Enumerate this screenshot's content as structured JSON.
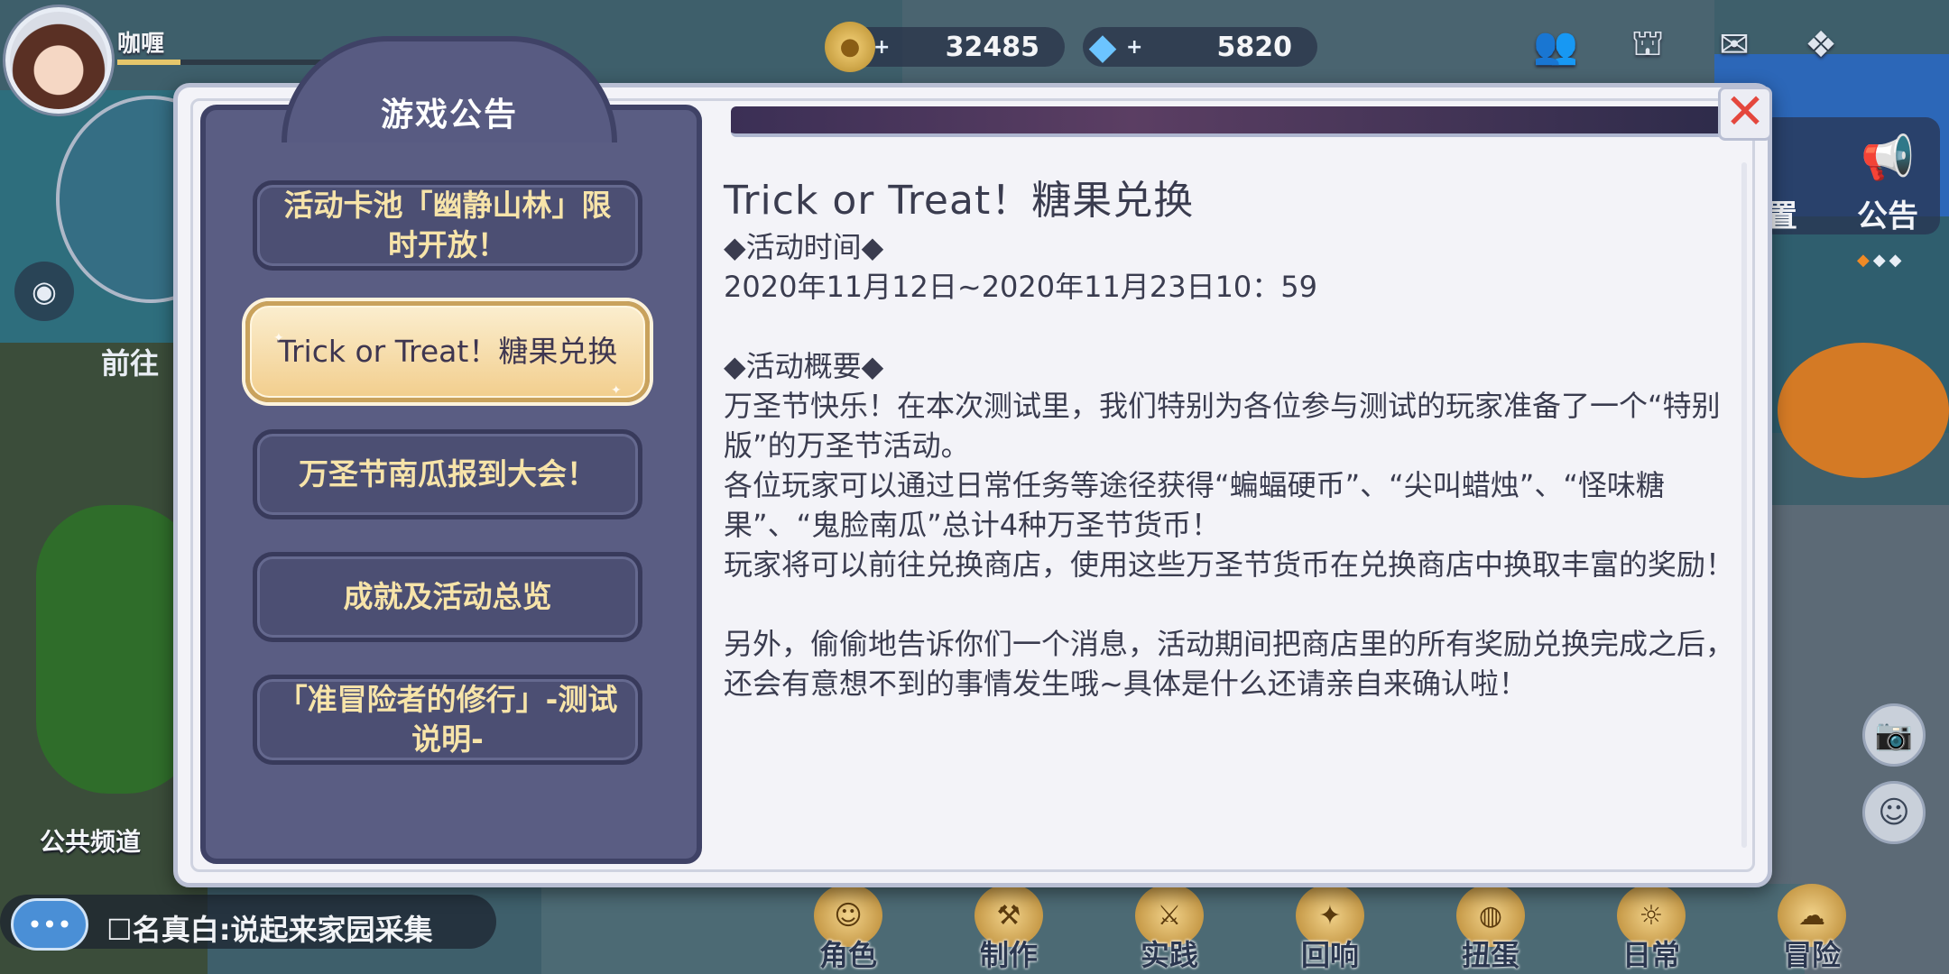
{
  "player": {
    "name": "咖喱",
    "exp_fraction": 0.28
  },
  "currencies": {
    "gold": {
      "value": "32485",
      "icon": "gold-coin-icon",
      "plus": "+"
    },
    "gem": {
      "value": "5820",
      "icon": "crystal-gem-icon",
      "plus": "+"
    }
  },
  "top_icons": [
    "friends-icon",
    "bag-icon",
    "mail-icon",
    "menu-diamond-icon"
  ],
  "side": {
    "settings_partial": "置",
    "announcement": "公告"
  },
  "left": {
    "goto_partial": "前往",
    "channel": "公共频道"
  },
  "chat": {
    "bubble": "•••",
    "message": "☐名真白:说起来家园采集"
  },
  "bottom_menu": [
    {
      "label": "角色",
      "icon": "character-icon"
    },
    {
      "label": "制作",
      "icon": "crafting-icon"
    },
    {
      "label": "实践",
      "icon": "practice-icon"
    },
    {
      "label": "回响",
      "icon": "echo-icon"
    },
    {
      "label": "扭蛋",
      "icon": "gacha-icon"
    },
    {
      "label": "日常",
      "icon": "daily-icon"
    },
    {
      "label": "冒险",
      "icon": "adventure-icon"
    }
  ],
  "dialog": {
    "panel_title": "游戏公告",
    "nav_items": [
      {
        "label": "活动卡池「幽静山林」限时开放！",
        "active": false
      },
      {
        "label": "Trick or Treat！糖果兑换",
        "active": true
      },
      {
        "label": "万圣节南瓜报到大会！",
        "active": false
      },
      {
        "label": "成就及活动总览",
        "active": false
      },
      {
        "label": "「准冒险者的修行」-测试说明-",
        "active": false
      }
    ],
    "content": {
      "title": "Trick or Treat！糖果兑换",
      "time_heading": "◆活动时间◆",
      "time_value": "2020年11月12日~2020年11月23日10：59",
      "overview_heading": "◆活动概要◆",
      "para1": "万圣节快乐！在本次测试里，我们特别为各位参与测试的玩家准备了一个“特别版”的万圣节活动。",
      "para2": "各位玩家可以通过日常任务等途径获得“蝙蝠硬币”、“尖叫蜡烛”、“怪味糖果”、“鬼脸南瓜”总计4种万圣节货币！",
      "para3": "玩家将可以前往兑换商店，使用这些万圣节货币在兑换商店中换取丰富的奖励！",
      "para4": "另外，偷偷地告诉你们一个消息，活动期间把商店里的所有奖励兑换完成之后，还会有意想不到的事情发生哦~具体是什么还请亲自来确认啦！"
    },
    "close": "✕"
  }
}
